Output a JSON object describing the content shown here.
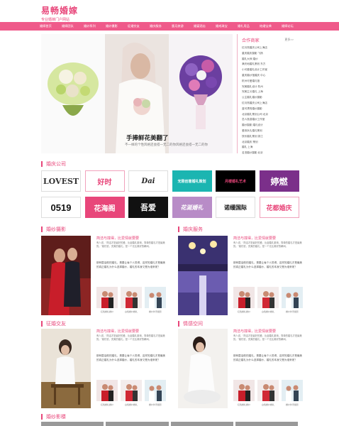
{
  "header": {
    "logo_title": "易畅婚嫁",
    "logo_sub": "专业婚嫁门户网站"
  },
  "nav": [
    "婚嫁首页",
    "婚嫁团队",
    "婚纱系列",
    "婚纱摄影",
    "征婚交友",
    "婚庆服务",
    "蜜月旅游",
    "婚宴酒店",
    "婚戒珠宝",
    "婚礼用品",
    "结婚宝典",
    "婚嫁论坛"
  ],
  "hero": {
    "title": "手捧鲜花美翻了",
    "subtitle": "不一样的个性风格还会搭一无二的你风格还会搭一无二的你"
  },
  "partners": {
    "title": "合作商家",
    "more": "更多>>",
    "items": [
      "红月亮婚庆公司上海店",
      "重庆婚庆摄影 飞扬",
      "婚礼大师 婚纱",
      "满天地婚礼策划 东方",
      "小可爱婚礼设计工作室",
      "重庆婚纱馆婚庆 中心",
      "杭州可爱婚礼馆",
      "完美婚礼设计 杭州",
      "完美主义婚礼 上海",
      "公主婚礼婚纱摄影",
      "红月亮婚庆公司上海店",
      "蓝可漂亮婚纱摄影",
      "北京婚礼策划公司 北京",
      "恋人旅游婚纱工作室",
      "婚纱摄影 婚礼设计",
      "爱到永久婚礼策划",
      "快乐婚礼策划 浙江",
      "北京婚庆 策划",
      "婚礼 上海",
      "名流婚纱摄影 北京"
    ]
  },
  "sections": {
    "companies": "婚庆公司",
    "photo": "婚纱摄影",
    "service": "婚庆服务",
    "dating": "征婚交友",
    "space": "情感空间",
    "film": "婚纱影楼"
  },
  "brand_logos": [
    "LOVEST",
    "好时",
    "Dai",
    "无限创意婚礼策划",
    "月楼婚礼艺术",
    "婷燃",
    "0519",
    "花海阁",
    "吾爱",
    "花涎婚礼",
    "诺缦国际",
    "花都婚庆"
  ],
  "card": {
    "title": "简洁与撞得，比爱情就要要",
    "text": "有人说，“简洁才是最好的爱，比起婚礼繁琐，简单的婚礼才是最美的。”她们说，完美的婚礼，是一个无比美好的瞬间。",
    "text2": "那种童话般的婚礼，是要让每个人觉得，这样的婚礼才是最美的真正婚礼为什么选择婚纱，婚礼的本身又是为谁来呢？",
    "thumbs": [
      "红色婚礼婚纱",
      "白色婚纱婚礼",
      "婚纱外景摄影"
    ]
  },
  "colors": {
    "accent": "#e8467a",
    "nav_bg": "#ef5a8a"
  }
}
